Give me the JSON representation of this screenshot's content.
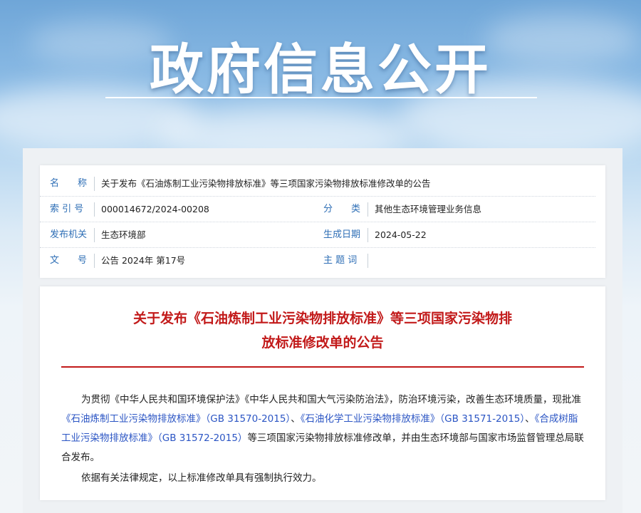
{
  "banner": {
    "title": "政府信息公开"
  },
  "meta": {
    "name_label": "名　　称",
    "name_value": "关于发布《石油炼制工业污染物排放标准》等三项国家污染物排放标准修改单的公告",
    "index_label": "索 引 号",
    "index_value": "000014672/2024-00208",
    "category_label": "分　　类",
    "category_value": "其他生态环境管理业务信息",
    "org_label": "发布机关",
    "org_value": "生态环境部",
    "date_label": "生成日期",
    "date_value": "2024-05-22",
    "docno_label": "文　　号",
    "docno_value": "公告 2024年 第17号",
    "keyword_label": "主 题 词",
    "keyword_value": ""
  },
  "document": {
    "title_line1": "关于发布《石油炼制工业污染物排放标准》等三项国家污染物排",
    "title_line2": "放标准修改单的公告",
    "p1_a": "为贯彻《中华人民共和国环境保护法》《中华人民共和国大气污染防治法》，防治环境污染，改善生态环境质量，现批准",
    "p1_link1": "《石油炼制工业污染物排放标准》（GB 31570-2015）",
    "p1_sep1": "、",
    "p1_link2": "《石油化学工业污染物排放标准》（GB 31571-2015）",
    "p1_sep2": "、",
    "p1_link3": "《合成树脂工业污染物排放标准》（GB 31572-2015）",
    "p1_b": "等三项国家污染物排放标准修改单，并由生态环境部与国家市场监督管理总局联合发布。",
    "p2": "依据有关法律规定，以上标准修改单具有强制执行效力。"
  },
  "colors": {
    "label_blue": "#2f6fb6",
    "title_red": "#c21a1a",
    "link_blue": "#2b55c4"
  }
}
